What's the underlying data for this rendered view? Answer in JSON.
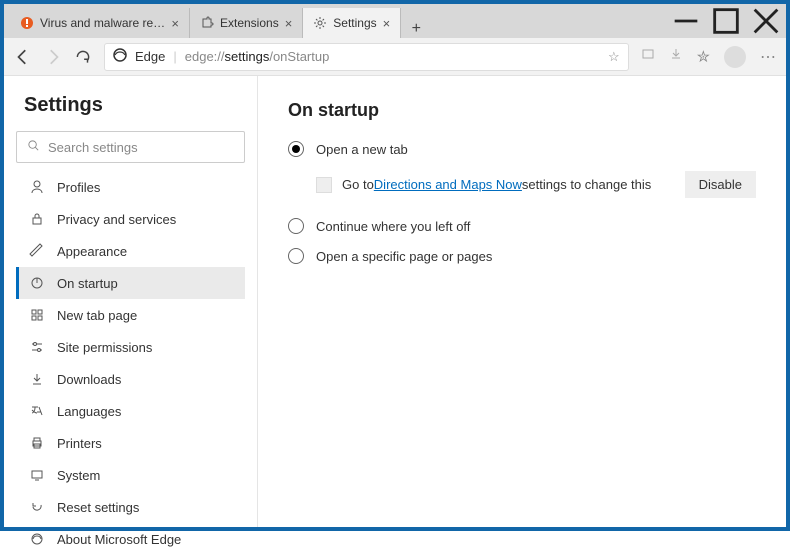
{
  "window": {
    "tabs": [
      {
        "label": "Virus and malware removal instr",
        "active": false
      },
      {
        "label": "Extensions",
        "active": false
      },
      {
        "label": "Settings",
        "active": true
      }
    ]
  },
  "addressbar": {
    "browser_label": "Edge",
    "url_prefix": "edge://",
    "url_bold": "settings",
    "url_suffix": "/onStartup"
  },
  "sidebar": {
    "title": "Settings",
    "search_placeholder": "Search settings",
    "items": [
      {
        "label": "Profiles"
      },
      {
        "label": "Privacy and services"
      },
      {
        "label": "Appearance"
      },
      {
        "label": "On startup"
      },
      {
        "label": "New tab page"
      },
      {
        "label": "Site permissions"
      },
      {
        "label": "Downloads"
      },
      {
        "label": "Languages"
      },
      {
        "label": "Printers"
      },
      {
        "label": "System"
      },
      {
        "label": "Reset settings"
      },
      {
        "label": "About Microsoft Edge"
      }
    ]
  },
  "main": {
    "heading": "On startup",
    "options": {
      "open_new_tab": "Open a new tab",
      "continue": "Continue where you left off",
      "specific": "Open a specific page or pages"
    },
    "extension_row": {
      "prefix": "Go to ",
      "link": "Directions and Maps Now",
      "suffix": " settings to change this",
      "disable": "Disable"
    }
  }
}
